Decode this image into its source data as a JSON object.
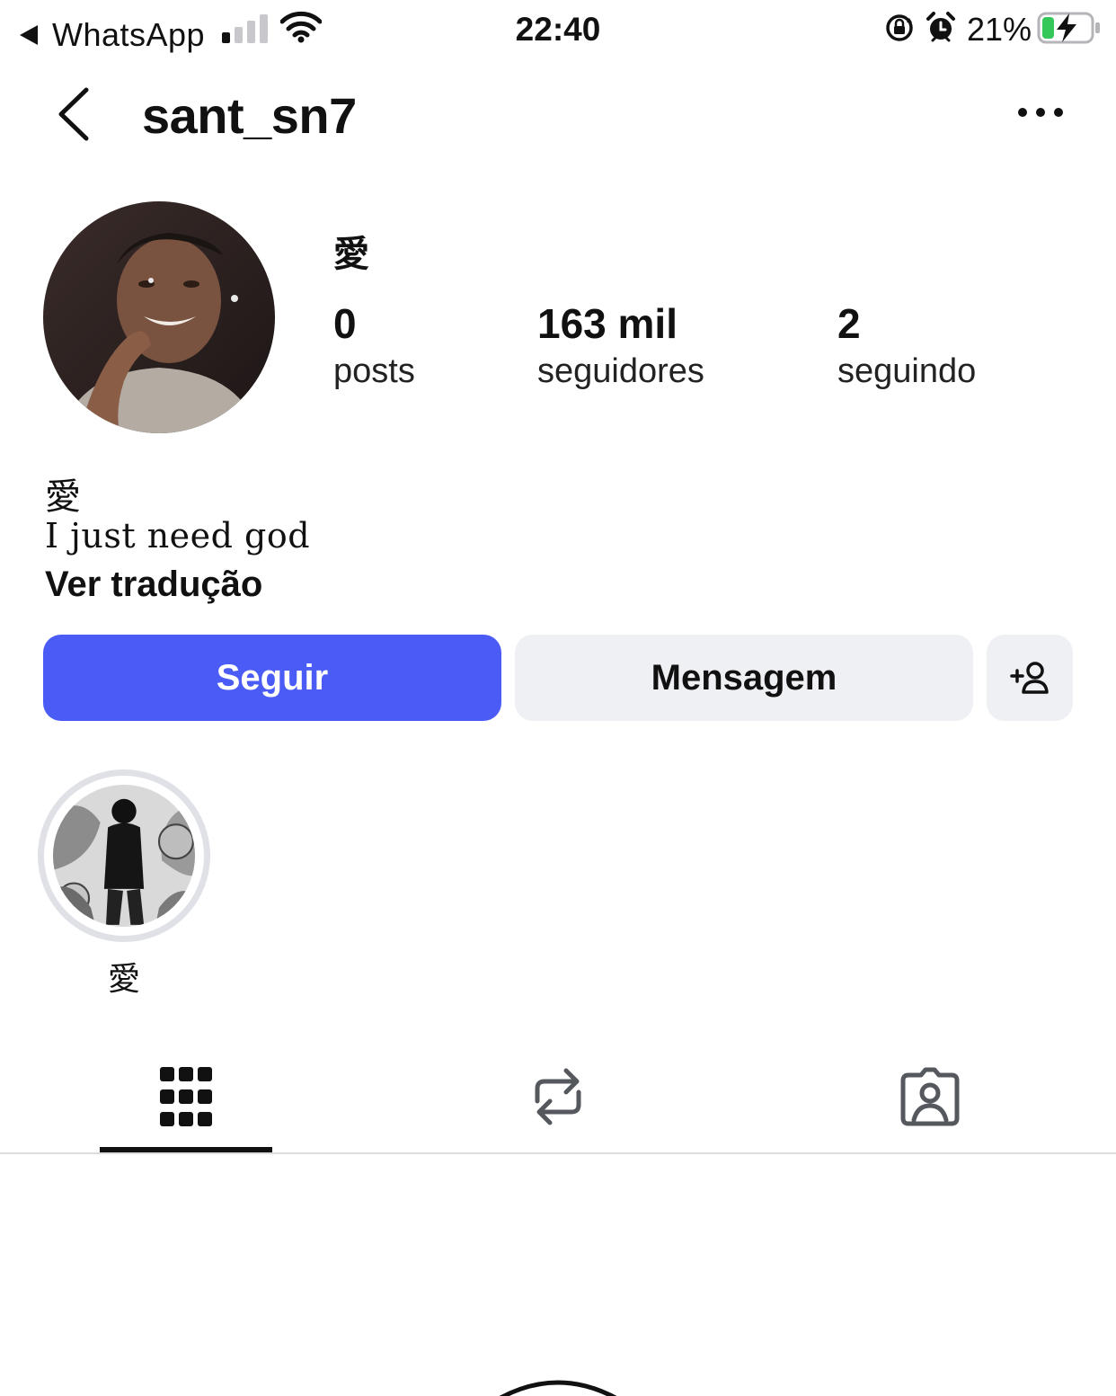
{
  "status_bar": {
    "back_app": "WhatsApp",
    "time": "22:40",
    "battery_percent": "21%",
    "signal_bars_filled": 1,
    "signal_bars_total": 4,
    "battery_level": 0.21,
    "battery_charging": true,
    "colors": {
      "battery_fill": "#34c759",
      "signal_inactive": "#c7c7cc"
    }
  },
  "header": {
    "username": "sant_sn7",
    "back_icon": "chevron-left-icon",
    "more_icon": "more-horizontal-icon"
  },
  "profile": {
    "display_name": "愛",
    "stats": [
      {
        "value": "0",
        "label": "posts"
      },
      {
        "value": "163 mil",
        "label": "seguidores"
      },
      {
        "value": "2",
        "label": "seguindo"
      }
    ],
    "bio_name": "愛",
    "bio_text": "I just need god",
    "see_translation": "Ver tradução"
  },
  "actions": {
    "follow_label": "Seguir",
    "message_label": "Mensagem",
    "add_user_icon": "add-user-icon",
    "colors": {
      "follow_bg": "#4a5cf5",
      "secondary_bg": "#eff0f4"
    }
  },
  "highlights": [
    {
      "label": "愛"
    }
  ],
  "tabs": [
    {
      "icon": "grid-icon",
      "active": true
    },
    {
      "icon": "reposts-icon",
      "active": false
    },
    {
      "icon": "tagged-icon",
      "active": false
    }
  ]
}
